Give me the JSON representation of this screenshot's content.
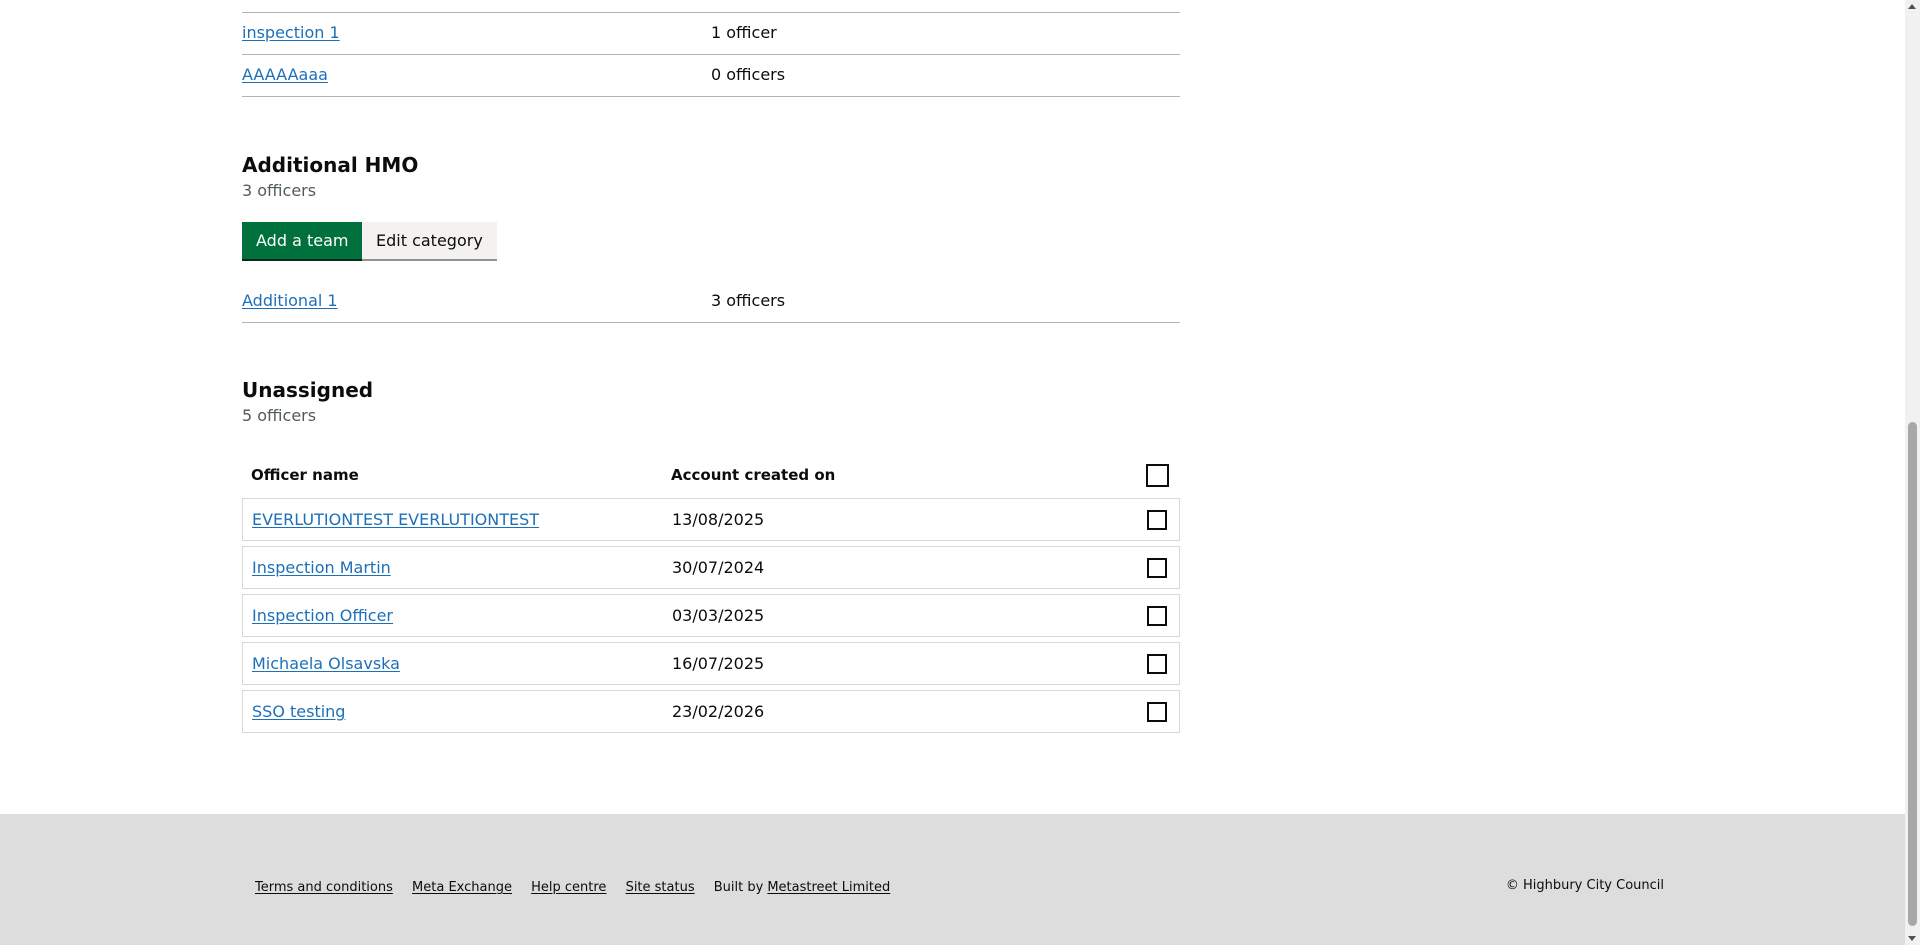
{
  "top_teams": [
    {
      "name": "inspection 1",
      "count": "1 officer"
    },
    {
      "name": "AAAAAaaa",
      "count": "0 officers"
    }
  ],
  "additional_hmo": {
    "title": "Additional HMO",
    "count": "3 officers",
    "add_team_label": "Add a team",
    "edit_category_label": "Edit category",
    "teams": [
      {
        "name": "Additional 1",
        "count": "3 officers"
      }
    ]
  },
  "unassigned": {
    "title": "Unassigned",
    "count": "5 officers",
    "columns": {
      "name": "Officer name",
      "created": "Account created on"
    },
    "officers": [
      {
        "name": "EVERLUTIONTEST EVERLUTIONTEST",
        "created": "13/08/2025"
      },
      {
        "name": "Inspection Martin",
        "created": "30/07/2024"
      },
      {
        "name": "Inspection Officer",
        "created": "03/03/2025"
      },
      {
        "name": "Michaela Olsavska",
        "created": "16/07/2025"
      },
      {
        "name": "SSO testing",
        "created": "23/02/2026"
      }
    ]
  },
  "footer": {
    "links": [
      "Terms and conditions",
      "Meta Exchange",
      "Help centre",
      "Site status"
    ],
    "built_by_prefix": "Built by",
    "built_by_link": "Metastreet Limited",
    "copyright": "© Highbury City Council"
  },
  "colors": {
    "link": "#1d70b8",
    "primary_button": "#00703c",
    "footer_bg": "#dddddd"
  }
}
